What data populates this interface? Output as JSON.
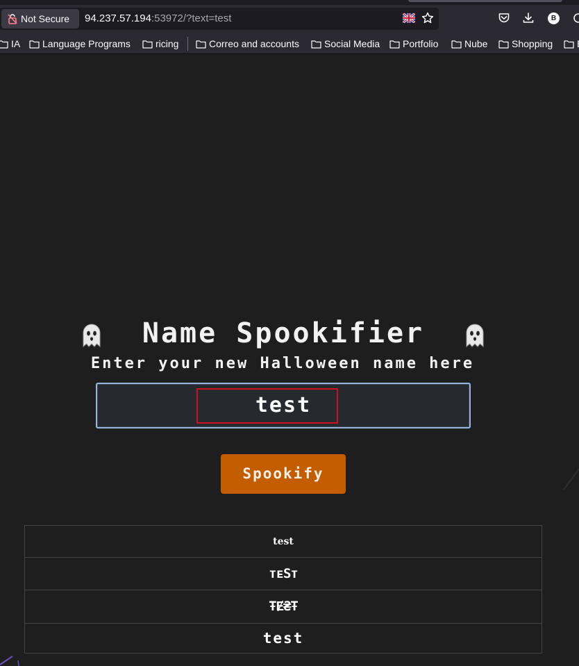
{
  "browser": {
    "security_label": "Not Secure",
    "url_host": "94.237.57.194",
    "url_rest": ":53972/?text=test",
    "profile_initial": "B"
  },
  "bookmarks": [
    {
      "label": "IA"
    },
    {
      "label": "Language Programs"
    },
    {
      "label": "ricing"
    },
    {
      "label": "Correo and accounts"
    },
    {
      "label": "Social Media"
    },
    {
      "label": "Portfolio"
    },
    {
      "label": "Nube"
    },
    {
      "label": "Shopping"
    },
    {
      "label": "E"
    }
  ],
  "app": {
    "title": "Name Spookifier",
    "subtitle": "Enter your new Halloween name here",
    "input_value": "test",
    "button_label": "Spookify",
    "accent_color": "#c35d00"
  },
  "results": [
    {
      "text": "test"
    },
    {
      "text": "ᴛᴇSᴛ"
    },
    {
      "text": "ŦɆ₴Ŧ"
    },
    {
      "text": "test"
    }
  ]
}
